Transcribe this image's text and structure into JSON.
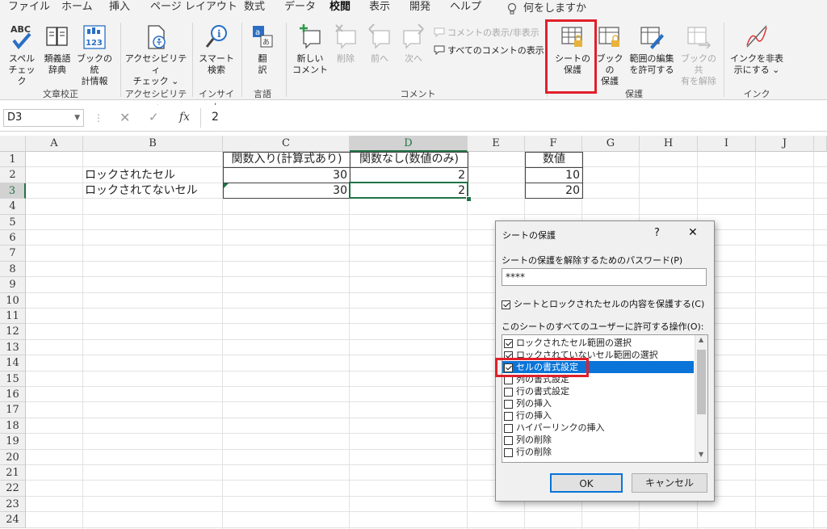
{
  "tabs": [
    "ファイル",
    "ホーム",
    "挿入",
    "ページ レイアウト",
    "数式",
    "データ",
    "校閲",
    "表示",
    "開発",
    "ヘルプ"
  ],
  "active_tab": "校閲",
  "tell_me": "何をしますか",
  "ribbon": {
    "spell": {
      "label1": "スペル",
      "label2": "チェック",
      "icon_text": "ABC"
    },
    "thesaurus": {
      "label1": "類義語",
      "label2": "辞典"
    },
    "stats": {
      "label1": "ブックの統",
      "label2": "計情報",
      "icon_text": "123"
    },
    "accessibility": {
      "label1": "アクセシビリティ",
      "label2": "チェック ⌄"
    },
    "smart_lookup": {
      "label1": "スマート",
      "label2": "検索"
    },
    "translate": {
      "label1": "翻",
      "label2": "訳"
    },
    "new_comment": {
      "label1": "新しい",
      "label2": "コメント"
    },
    "delete": "削除",
    "prev": "前へ",
    "next": "次へ",
    "show_hide_comment": "コメントの表示/非表示",
    "show_all_comments": "すべてのコメントの表示",
    "protect_sheet": {
      "label1": "シートの",
      "label2": "保護"
    },
    "protect_book": {
      "label1": "ブックの",
      "label2": "保護"
    },
    "allow_edit": {
      "label1": "範囲の編集",
      "label2": "を許可する"
    },
    "unshare": {
      "label1": "ブックの共",
      "label2": "有を解除"
    },
    "hide_ink": {
      "label1": "インクを非表",
      "label2": "示にする ⌄"
    },
    "groups": {
      "proofing": "文章校正",
      "accessibility": "アクセシビリティ",
      "insights": "インサイト",
      "language": "言語",
      "comments": "コメント",
      "protect": "保護",
      "ink": "インク"
    }
  },
  "formula_bar": {
    "name_box": "D3",
    "fx": "fx",
    "value": "2"
  },
  "columns": [
    "A",
    "B",
    "C",
    "D",
    "E",
    "F",
    "G",
    "H",
    "I",
    "J"
  ],
  "selected_column": "D",
  "rows": [
    "1",
    "2",
    "3",
    "4",
    "5",
    "6",
    "7",
    "8",
    "9",
    "10",
    "11",
    "12",
    "13",
    "14",
    "15",
    "16",
    "17",
    "18",
    "19",
    "20",
    "21",
    "22",
    "23",
    "24"
  ],
  "selected_row": "3",
  "cells": {
    "C1": "関数入り(計算式あり)",
    "D1": "関数なし(数値のみ)",
    "B2": "ロックされたセル",
    "C2": "30",
    "D2": "2",
    "B3": "ロックされてないセル",
    "C3": "30",
    "D3": "2",
    "F1": "数値",
    "F2": "10",
    "F3": "20"
  },
  "dialog": {
    "title": "シートの保護",
    "help": "?",
    "close": "✕",
    "password_label": "シートの保護を解除するためのパスワード(P)",
    "password_value": "****",
    "protect_checkbox_label": "シートとロックされたセルの内容を保護する(C)",
    "allow_label": "このシートのすべてのユーザーに許可する操作(O):",
    "options": [
      {
        "label": "ロックされたセル範囲の選択",
        "checked": true
      },
      {
        "label": "ロックされていないセル範囲の選択",
        "checked": true
      },
      {
        "label": "セルの書式設定",
        "checked": true
      },
      {
        "label": "列の書式設定",
        "checked": false
      },
      {
        "label": "行の書式設定",
        "checked": false
      },
      {
        "label": "列の挿入",
        "checked": false
      },
      {
        "label": "行の挿入",
        "checked": false
      },
      {
        "label": "ハイパーリンクの挿入",
        "checked": false
      },
      {
        "label": "列の削除",
        "checked": false
      },
      {
        "label": "行の削除",
        "checked": false
      }
    ],
    "selected_option": "セルの書式設定",
    "ok": "OK",
    "cancel": "キャンセル"
  },
  "colors": {
    "accent": "#217346",
    "highlight": "#e0202a",
    "selection": "#0a74d8"
  }
}
